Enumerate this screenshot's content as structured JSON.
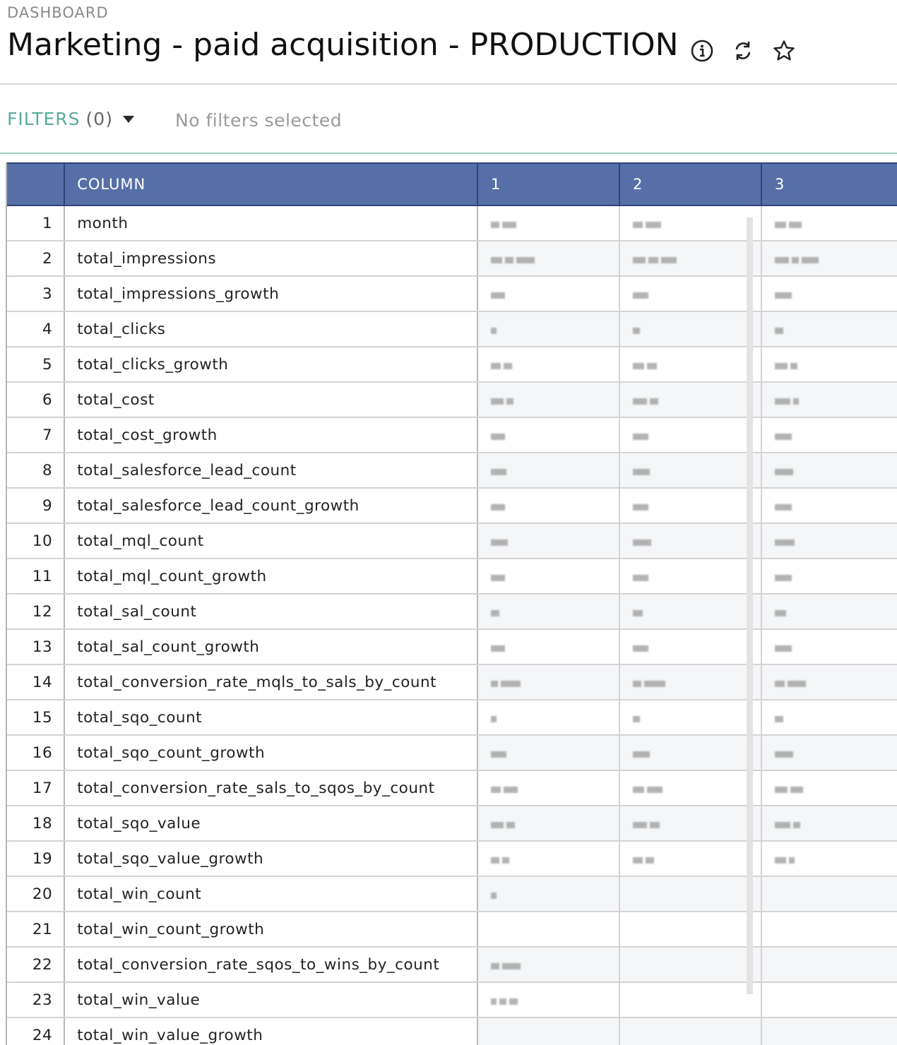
{
  "breadcrumb": "DASHBOARD",
  "title": "Marketing - paid acquisition - PRODUCTION",
  "icons": {
    "info": "info-icon",
    "refresh": "refresh-icon",
    "favorite": "star-icon"
  },
  "filters": {
    "label": "FILTERS",
    "count": "(0)",
    "status": "No filters selected"
  },
  "table": {
    "headers": [
      "",
      "COLUMN",
      "1",
      "2",
      "3"
    ],
    "rows": [
      {
        "index": "1",
        "name": "month"
      },
      {
        "index": "2",
        "name": "total_impressions"
      },
      {
        "index": "3",
        "name": "total_impressions_growth"
      },
      {
        "index": "4",
        "name": "total_clicks"
      },
      {
        "index": "5",
        "name": "total_clicks_growth"
      },
      {
        "index": "6",
        "name": "total_cost"
      },
      {
        "index": "7",
        "name": "total_cost_growth"
      },
      {
        "index": "8",
        "name": "total_salesforce_lead_count"
      },
      {
        "index": "9",
        "name": "total_salesforce_lead_count_growth"
      },
      {
        "index": "10",
        "name": "total_mql_count"
      },
      {
        "index": "11",
        "name": "total_mql_count_growth"
      },
      {
        "index": "12",
        "name": "total_sal_count"
      },
      {
        "index": "13",
        "name": "total_sal_count_growth"
      },
      {
        "index": "14",
        "name": "total_conversion_rate_mqls_to_sals_by_count"
      },
      {
        "index": "15",
        "name": "total_sqo_count"
      },
      {
        "index": "16",
        "name": "total_sqo_count_growth"
      },
      {
        "index": "17",
        "name": "total_conversion_rate_sals_to_sqos_by_count"
      },
      {
        "index": "18",
        "name": "total_sqo_value"
      },
      {
        "index": "19",
        "name": "total_sqo_value_growth"
      },
      {
        "index": "20",
        "name": "total_win_count"
      },
      {
        "index": "21",
        "name": "total_win_count_growth"
      },
      {
        "index": "22",
        "name": "total_conversion_rate_sqos_to_wins_by_count"
      },
      {
        "index": "23",
        "name": "total_win_value"
      },
      {
        "index": "24",
        "name": "total_win_value_growth"
      }
    ]
  },
  "colors": {
    "header_bg": "#5670a7",
    "filters_accent": "#5bab9b"
  }
}
